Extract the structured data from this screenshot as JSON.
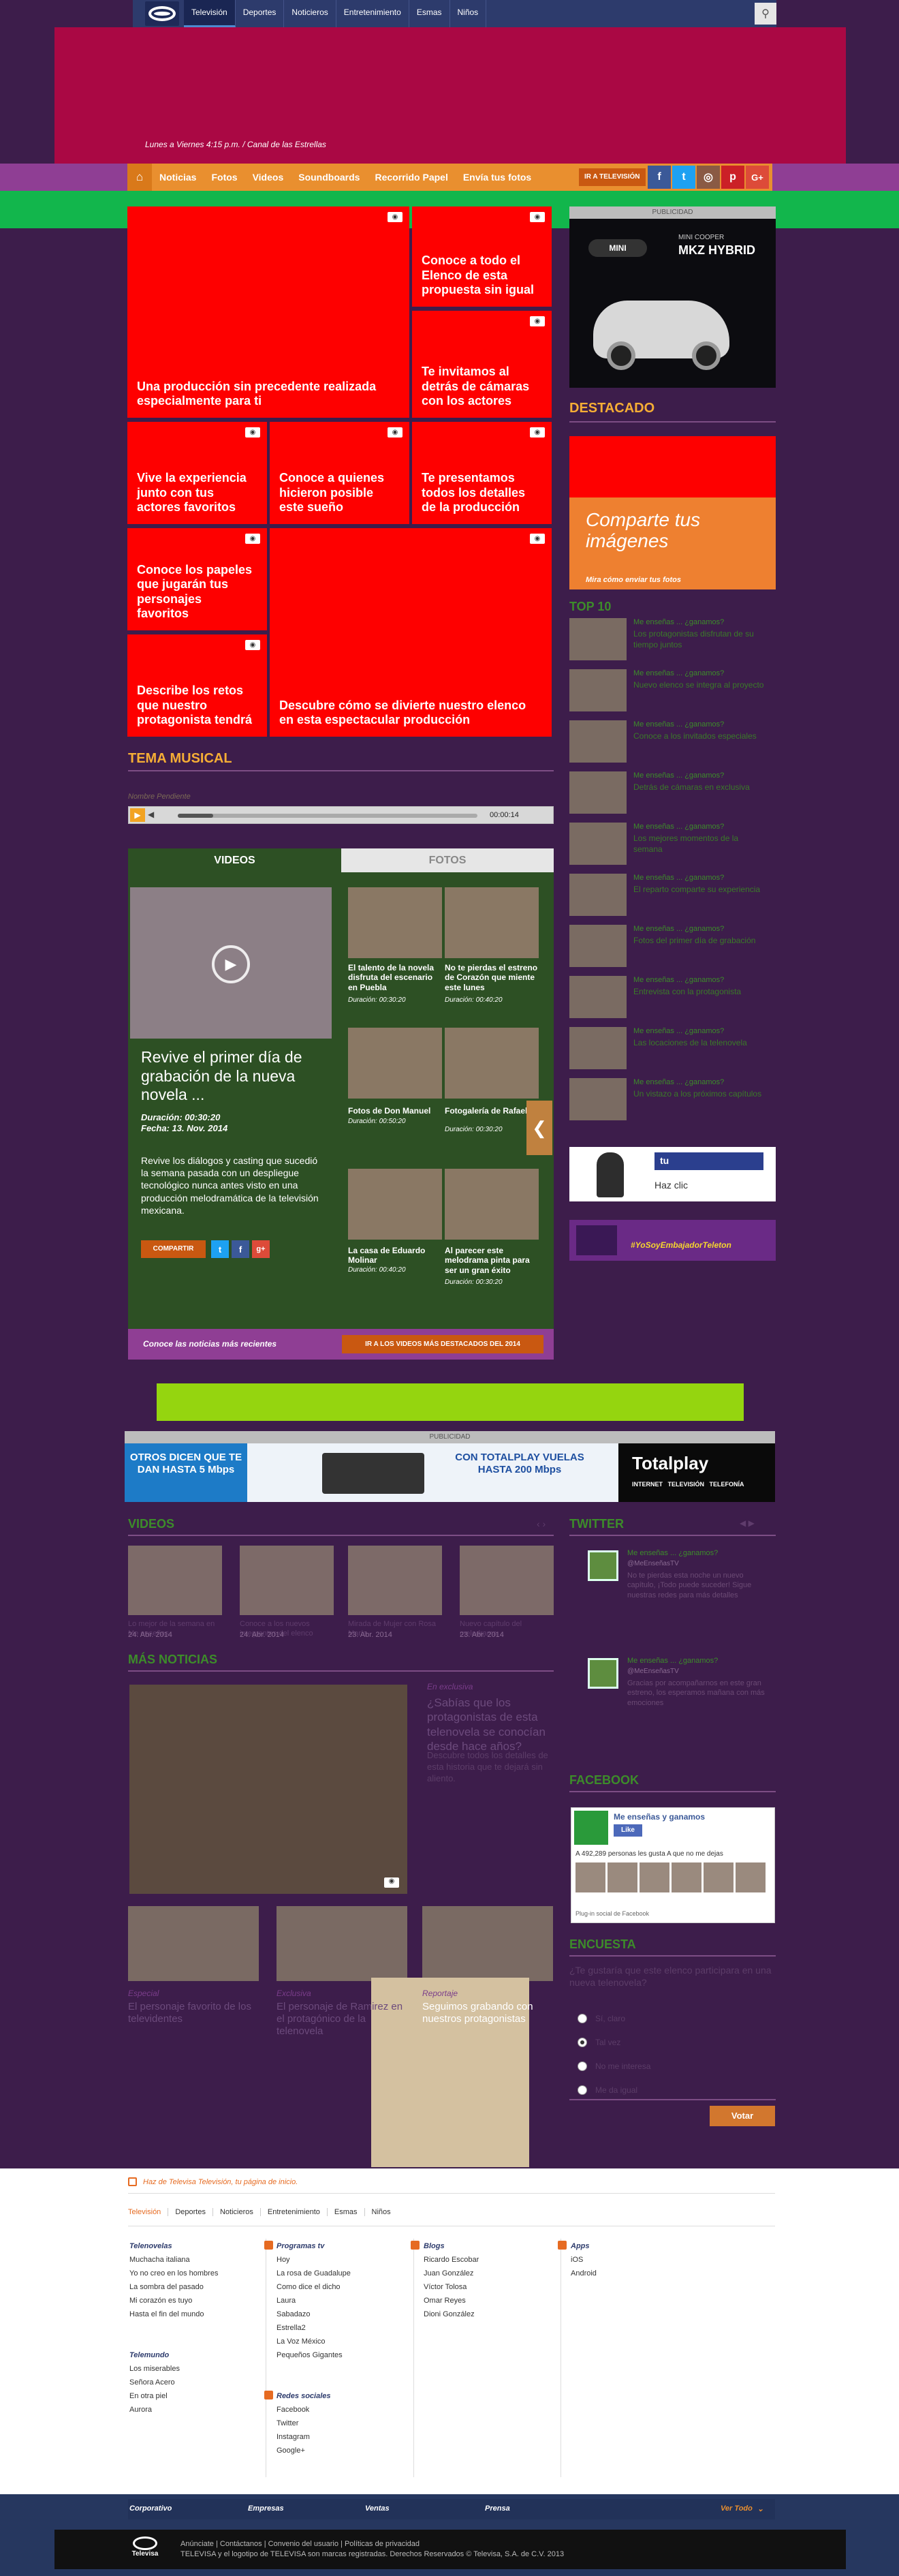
{
  "topnav": {
    "items": [
      "Televisión",
      "Deportes",
      "Noticieros",
      "Entretenimiento",
      "Esmas",
      "Niños"
    ],
    "search_icon": "search-icon"
  },
  "hero": {
    "subtitle": "Lunes a Viernes 4:15 p.m. / Canal de las Estrellas"
  },
  "mainnav": {
    "items": [
      "Noticias",
      "Fotos",
      "Videos",
      "Soundboards",
      "Recorrido Papel",
      "Envía tus fotos"
    ],
    "tele_button": "IR A TELEVISIÓN",
    "social": [
      "f",
      "t",
      "◎",
      "p",
      "G+"
    ]
  },
  "mosaic": [
    "Conoce a todo el Elenco de esta propuesta sin igual",
    "Una producción sin precedente realizada especialmente para ti",
    "Te invitamos al detrás de cámaras con los actores",
    "Vive la experiencia junto con tus actores favoritos",
    "Conoce a quienes hicieron posible este sueño",
    "Te presentamos todos los detalles de la producción",
    "Conoce los papeles que jugarán tus personajes favoritos",
    "Describe los retos que nuestro protagonista tendrá",
    "Descubre cómo se divierte nuestro elenco en esta espectacular producción"
  ],
  "sidebar": {
    "publicidad": "PUBLICIDAD",
    "ad": {
      "brand": "MINI",
      "line1": "MINI COOPER",
      "line2": "MKZ HYBRID"
    },
    "destacado": "DESTACADO",
    "comparte_title": "Comparte tus imágenes",
    "comparte_link": "Mira cómo enviar tus fotos",
    "top_title": "TOP 10",
    "top_items": [
      {
        "kicker": "Me enseñas ... ¿ganamos?",
        "text": "Los protagonistas disfrutan de su tiempo juntos"
      },
      {
        "kicker": "Me enseñas ... ¿ganamos?",
        "text": "Nuevo elenco se integra al proyecto"
      },
      {
        "kicker": "Me enseñas ... ¿ganamos?",
        "text": "Conoce a los invitados especiales"
      },
      {
        "kicker": "Me enseñas ... ¿ganamos?",
        "text": "Detrás de cámaras en exclusiva"
      },
      {
        "kicker": "Me enseñas ... ¿ganamos?",
        "text": "Los mejores momentos de la semana"
      },
      {
        "kicker": "Me enseñas ... ¿ganamos?",
        "text": "El reparto comparte su experiencia"
      },
      {
        "kicker": "Me enseñas ... ¿ganamos?",
        "text": "Fotos del primer día de grabación"
      },
      {
        "kicker": "Me enseñas ... ¿ganamos?",
        "text": "Entrevista con la protagonista"
      },
      {
        "kicker": "Me enseñas ... ¿ganamos?",
        "text": "Las locaciones de la telenovela"
      },
      {
        "kicker": "Me enseñas ... ¿ganamos?",
        "text": "Un vistazo a los próximos capítulos"
      }
    ],
    "ad2_text": "Haz clic",
    "ad3_text": "#YoSoyEmbajadorTeleton"
  },
  "tema": {
    "title": "TEMA MUSICAL",
    "subtitle": "Nombre Pendiente",
    "time": "00:00:14"
  },
  "videos": {
    "tab_videos": "VIDEOS",
    "tab_fotos": "FOTOS",
    "featured_title": "Revive el primer día de grabación de la nueva novela ...",
    "featured_duration": "Duración: 00:30:20",
    "featured_date": "Fecha: 13. Nov. 2014",
    "featured_desc": "Revive los diálogos y casting que sucedió la semana pasada con un despliegue tecnológico nunca antes visto en una producción melodramática de la televisión mexicana.",
    "compartir": "COMPARTIR",
    "thumbs": [
      {
        "title": "El talento de la novela disfruta del escenario en Puebla",
        "dur": "Duración: 00:30:20"
      },
      {
        "title": "No te pierdas el estreno de Corazón que miente este lunes",
        "dur": "Duración: 00:40:20"
      },
      {
        "title": "Fotos de Don Manuel",
        "dur": "Duración: 00:50:20"
      },
      {
        "title": "Fotogalería de Rafaela",
        "dur": "Duración: 00:30:20"
      },
      {
        "title": "La casa de Eduardo Molinar",
        "dur": "Duración: 00:40:20"
      },
      {
        "title": "Al parecer este melodrama pinta para ser un gran éxito",
        "dur": "Duración: 00:30:20"
      }
    ],
    "footer_note": "Conoce las noticias más recientes",
    "footer_button": "IR A LOS VIDEOS MÁS DESTACADOS DEL 2014"
  },
  "banner": {
    "publicidad": "PUBLICIDAD",
    "left": "OTROS DICEN QUE TE DAN HASTA 5 Mbps",
    "mid": "CON TOTALPLAY VUELAS HASTA 200 Mbps",
    "brand": "Totalplay",
    "tags": "INTERNET   TELEVISIÓN   TELEFONÍA"
  },
  "strip": {
    "title": "VIDEOS",
    "items": [
      {
        "desc": "Lo mejor de la semana en Me enseñas",
        "date": "24. Abr. 2014"
      },
      {
        "desc": "Conoce a los nuevos integrantes del elenco",
        "date": "24. Abr. 2014"
      },
      {
        "desc": "Mirada de Mujer con Rosa María",
        "date": "23. Abr. 2014"
      },
      {
        "desc": "Nuevo capítulo del melodrama",
        "date": "23. Abr. 2014"
      }
    ]
  },
  "twitter": {
    "title": "TWITTER",
    "tweets": [
      {
        "name": "Me enseñas ... ¿ganamos?",
        "handle": "@MeEnseñasTV",
        "text": "No te pierdas esta noche un nuevo capítulo, ¡Todo puede suceder! Sigue nuestras redes para más detalles"
      },
      {
        "name": "Me enseñas ... ¿ganamos?",
        "handle": "@MeEnseñasTV",
        "text": "Gracias por acompañarnos en este gran estreno, los esperamos mañana con más emociones"
      }
    ]
  },
  "mas_noticias": {
    "title": "MÁS NOTICIAS",
    "kicker": "En exclusiva",
    "headline": "¿Sabías que los protagonistas de esta telenovela se conocían desde hace años?",
    "desc": "Descubre todos los detalles de esta historia que te dejará sin aliento.",
    "items": [
      {
        "kicker": "Especial",
        "title": "El personaje favorito de los televidentes"
      },
      {
        "kicker": "Exclusiva",
        "title": "El personaje de Ramirez en el protagónico de la telenovela"
      },
      {
        "kicker": "Reportaje",
        "title": "Seguimos grabando con nuestros protagonistas"
      }
    ]
  },
  "facebook": {
    "title": "FACEBOOK",
    "page": "Me enseñas y ganamos",
    "like": "Like",
    "count": "A 492,289 personas les gusta A que no me dejas",
    "plugin": "Plug-in social de Facebook"
  },
  "encuesta": {
    "title": "ENCUESTA",
    "question": "¿Te gustaría que este elenco participara en una nueva telenovela?",
    "options": [
      "Sí, claro",
      "Tal vez",
      "No me interesa",
      "Me da igual"
    ],
    "vote": "Votar"
  },
  "footer": {
    "hazte": "Haz de Televisa Televisión, tu página de inicio.",
    "nav": [
      "Televisión",
      "Deportes",
      "Noticieros",
      "Entretenimiento",
      "Esmas",
      "Niños"
    ],
    "telenovelas_title": "Telenovelas",
    "telenovelas": [
      "Muchacha italiana",
      "Yo no creo en los hombres",
      "La sombra del pasado",
      "Mi corazón es tuyo",
      "Hasta el fin del mundo"
    ],
    "telemundo_title": "Telemundo",
    "telemundo": [
      "Los miserables",
      "Señora Acero",
      "En otra piel",
      "Aurora"
    ],
    "programas_title": "Programas tv",
    "programas": [
      "Hoy",
      "La rosa de Guadalupe",
      "Como dice el dicho",
      "Laura",
      "Sabadazo",
      "Estrella2",
      "La Voz México",
      "Pequeños Gigantes"
    ],
    "redes_title": "Redes sociales",
    "redes": [
      "Facebook",
      "Twitter",
      "Instagram",
      "Google+"
    ],
    "blogs_title": "Blogs",
    "blogs": [
      "Ricardo Escobar",
      "Juan González",
      "Víctor Tolosa",
      "Omar Reyes",
      "Dioni González"
    ],
    "apps_title": "Apps",
    "apps": [
      "iOS",
      "Android"
    ],
    "corp": [
      "Corporativo",
      "Empresas",
      "Ventas",
      "Prensa"
    ],
    "ver_todo": "Ver Todo",
    "legal1": "Anúnciate | Contáctanos | Convenio del usuario | Políticas de privacidad",
    "legal2": "TELEVISA y el logotipo de TELEVISA son marcas registradas. Derechos Reservados © Televisa, S.A. de C.V. 2013",
    "brand": "Televisa"
  }
}
